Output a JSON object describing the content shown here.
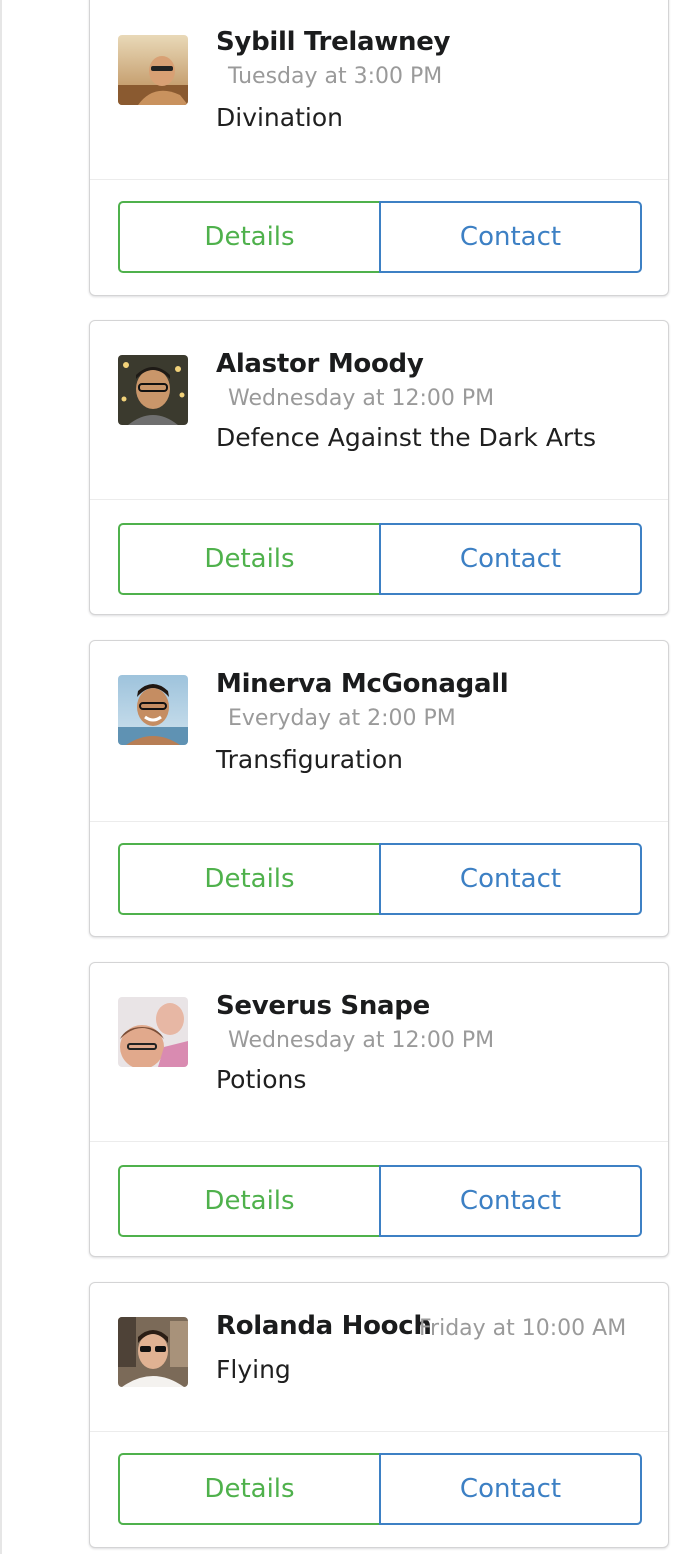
{
  "colors": {
    "details_green": "#4fb14c",
    "contact_blue": "#3d80c4",
    "meta_gray": "#9a9a9a"
  },
  "cards": [
    {
      "name": "Sybill Trelawney",
      "time": "Tuesday at 3:00 PM",
      "subject": "Divination",
      "avatar_icon": "user-avatar-photo",
      "details_label": "Details",
      "contact_label": "Contact"
    },
    {
      "name": "Alastor Moody",
      "time": "Wednesday at 12:00 PM",
      "subject": "Defence Against the Dark Arts",
      "avatar_icon": "user-avatar-photo",
      "details_label": "Details",
      "contact_label": "Contact"
    },
    {
      "name": "Minerva McGonagall",
      "time": "Everyday at 2:00 PM",
      "subject": "Transfiguration",
      "avatar_icon": "user-avatar-photo",
      "details_label": "Details",
      "contact_label": "Contact"
    },
    {
      "name": "Severus Snape",
      "time": "Wednesday at 12:00 PM",
      "subject": "Potions",
      "avatar_icon": "user-avatar-photo",
      "details_label": "Details",
      "contact_label": "Contact"
    },
    {
      "name": "Rolanda Hooch",
      "time": "Friday at 10:00 AM",
      "subject": "Flying",
      "avatar_icon": "user-avatar-photo",
      "details_label": "Details",
      "contact_label": "Contact"
    }
  ]
}
